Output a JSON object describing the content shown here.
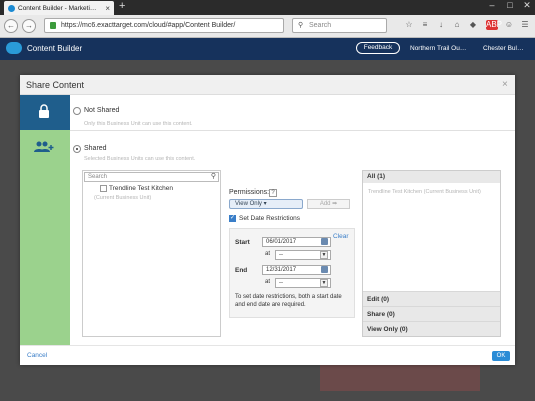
{
  "browser": {
    "tab_title": "Content Builder - Marketi…",
    "url": "https://mc6.exacttarget.com/cloud/#app/Content Builder/",
    "search_placeholder": "Search"
  },
  "app_header": {
    "app_name": "Content Builder",
    "feedback": "Feedback",
    "business_unit": "Northern Trail Ou…",
    "user": "Chester Bul…"
  },
  "modal": {
    "title": "Share Content",
    "close": "×",
    "not_shared": {
      "label": "Not Shared",
      "description": "Only this Business Unit can use this content."
    },
    "shared": {
      "label": "Shared",
      "description": "Selected Business Units can use this content.",
      "search_placeholder": "Search",
      "unit_name": "Trendline Test Kitchen",
      "unit_sub": "(Current Business Unit)"
    },
    "permissions": {
      "label": "Permissions:",
      "help": "?",
      "selected": "View Only ▾",
      "add": "Add ➡"
    },
    "date_restrictions": {
      "checkbox_label": "Set Date Restrictions",
      "clear": "Clear",
      "start_label": "Start",
      "start_date": "06/01/2017",
      "end_label": "End",
      "end_date": "12/31/2017",
      "at_label": "at",
      "time_placeholder": "--",
      "note": "To set date restrictions, both a start date and end date are required."
    },
    "right_panel": {
      "all": "All (1)",
      "item": "Trendline Test Kitchen (Current Business Unit)",
      "edit": "Edit (0)",
      "share": "Share (0)",
      "view_only": "View Only (0)"
    },
    "cancel": "Cancel",
    "ok": "OK"
  },
  "colors": {
    "header": "#16325c",
    "side_dark": "#1f5e8c",
    "side_green": "#9bd28d",
    "accent": "#2a8cd6"
  }
}
